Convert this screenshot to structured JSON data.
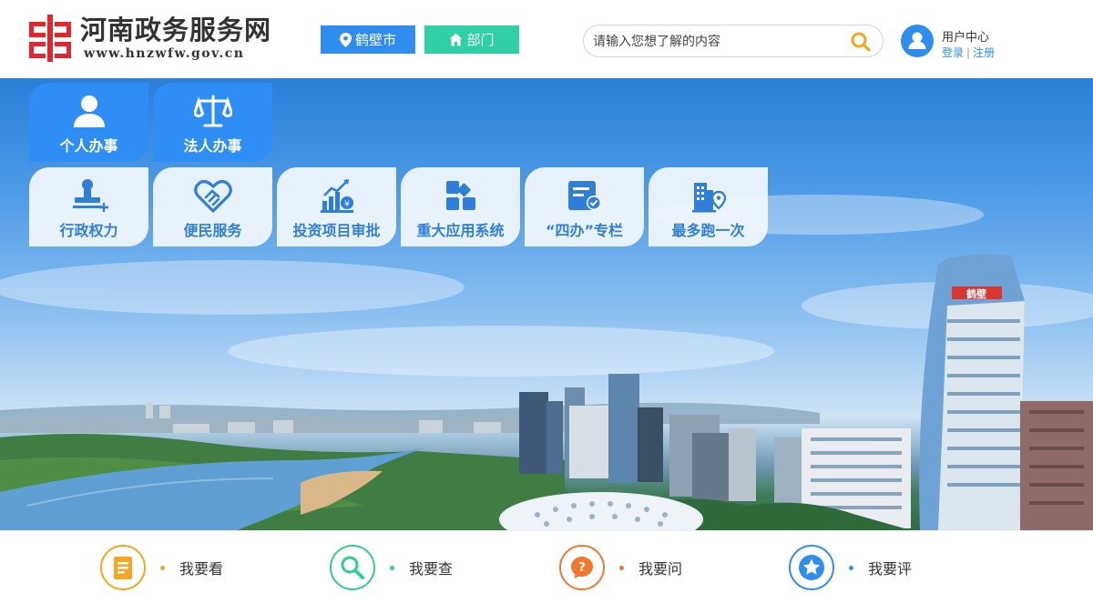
{
  "header": {
    "logo_title": "河南政务服务网",
    "logo_url": "www.hnzwfw.gov.cn",
    "city_label": "鹤壁市",
    "dept_label": "部门",
    "search_placeholder": "请输入您想了解的内容",
    "user_center": "用户中心",
    "login": "登录",
    "separator": "|",
    "register": "注册"
  },
  "colors": {
    "accent_blue": "#2f8df0",
    "accent_teal": "#2fd0a6",
    "search_icon": "#f5a623",
    "logo_red": "#e0262e"
  },
  "tiles": {
    "primary": [
      {
        "label": "个人办事",
        "icon": "person-icon"
      },
      {
        "label": "法人办事",
        "icon": "scales-icon"
      }
    ],
    "secondary": [
      {
        "label": "行政权力",
        "icon": "stamp-icon"
      },
      {
        "label": "便民服务",
        "icon": "handshake-icon"
      },
      {
        "label": "投资项目审批",
        "icon": "growth-chart-icon"
      },
      {
        "label": "重大应用系统",
        "icon": "app-grid-icon"
      },
      {
        "label": "“四办”专栏",
        "icon": "checklist-icon"
      },
      {
        "label": "最多跑一次",
        "icon": "building-location-icon"
      }
    ]
  },
  "banner": {
    "building_sign": "鹤壁"
  },
  "bottom_nav": [
    {
      "label": "我要看",
      "icon": "document-icon",
      "color": "#f5a623"
    },
    {
      "label": "我要查",
      "icon": "magnifier-icon",
      "color": "#2fcf8f"
    },
    {
      "label": "我要问",
      "icon": "question-icon",
      "color": "#f0792f"
    },
    {
      "label": "我要评",
      "icon": "star-icon",
      "color": "#2f8df0"
    }
  ]
}
